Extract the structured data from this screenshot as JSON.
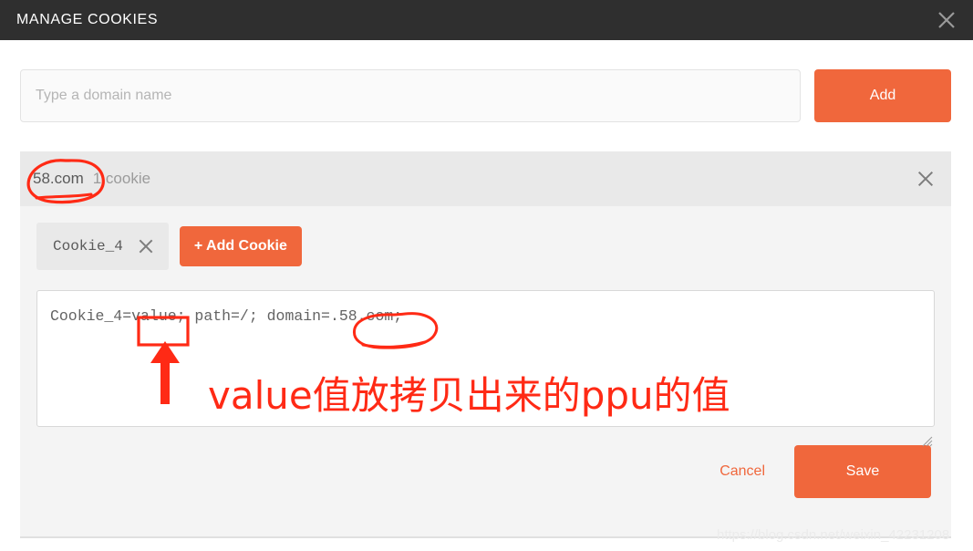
{
  "window": {
    "title": "MANAGE COOKIES",
    "close_icon": "close-icon",
    "accent_color": "#f0673c",
    "header_bg": "#2f2f2f"
  },
  "add_domain": {
    "input_value": "",
    "placeholder": "Type a domain name",
    "add_label": "Add"
  },
  "domain_group": {
    "name": "58.com",
    "cookie_count_label": "1 cookie",
    "remove_icon": "close-icon"
  },
  "cookie_editor": {
    "chips": [
      {
        "label": "Cookie_4",
        "close_icon": "close-icon"
      }
    ],
    "add_cookie_label": "+ Add Cookie",
    "textarea_value": "Cookie_4=value; path=/; domain=.58.com;",
    "textarea_placeholder": "",
    "cancel_label": "Cancel",
    "save_label": "Save",
    "resize_grip_icon": "resize-grip-icon"
  },
  "annotations": {
    "note_text": "value值放拷贝出来的ppu的值",
    "note_color": "#ff2a15",
    "circle_domain_target": "58.com",
    "box_target": "value",
    "circle_textarea_target": ".58.com;",
    "arrow_icon": "up-arrow-annotation"
  },
  "watermark": {
    "text": "https://blog.csdn.net/weixin_42231208"
  }
}
